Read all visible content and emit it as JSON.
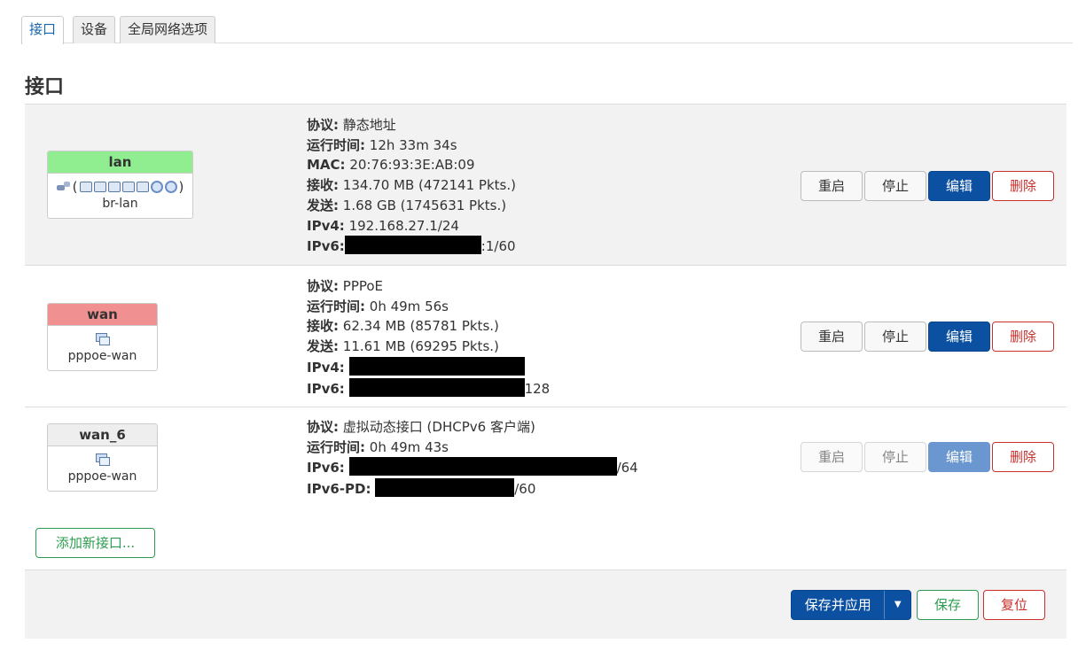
{
  "tabs": [
    {
      "label": "接口",
      "active": true
    },
    {
      "label": "设备",
      "active": false
    },
    {
      "label": "全局网络选项",
      "active": false
    }
  ],
  "page_title": "接口",
  "interfaces": [
    {
      "name": "lan",
      "name_color": "#90ee90",
      "device": "br-lan",
      "info": [
        {
          "label": "协议:",
          "value": "静态地址"
        },
        {
          "label": "运行时间:",
          "value": "12h 33m 34s"
        },
        {
          "label": "MAC:",
          "value": "20:76:93:3E:AB:09"
        },
        {
          "label": "接收:",
          "value": "134.70 MB (472141 Pkts.)"
        },
        {
          "label": "发送:",
          "value": "1.68 GB (1745631 Pkts.)"
        },
        {
          "label": "IPv4:",
          "value": "192.168.27.1/24"
        },
        {
          "label": "IPv6:",
          "value": ":1/60",
          "redacted": true
        }
      ],
      "buttons": {
        "restart": "重启",
        "stop": "停止",
        "edit": "编辑",
        "delete": "删除"
      }
    },
    {
      "name": "wan",
      "name_color": "#f09090",
      "device": "pppoe-wan",
      "info": [
        {
          "label": "协议:",
          "value": "PPPoE"
        },
        {
          "label": "运行时间:",
          "value": "0h 49m 56s"
        },
        {
          "label": "接收:",
          "value": "62.34 MB (85781 Pkts.)"
        },
        {
          "label": "发送:",
          "value": "11.61 MB (69295 Pkts.)"
        },
        {
          "label": "IPv4:",
          "value": "",
          "redacted": true
        },
        {
          "label": "IPv6:",
          "value": "128",
          "redacted": true
        }
      ],
      "buttons": {
        "restart": "重启",
        "stop": "停止",
        "edit": "编辑",
        "delete": "删除"
      }
    },
    {
      "name": "wan_6",
      "name_color": "#eeeeee",
      "device": "pppoe-wan",
      "info": [
        {
          "label": "协议:",
          "value": "虚拟动态接口 (DHCPv6 客户端)"
        },
        {
          "label": "运行时间:",
          "value": "0h 49m 43s"
        },
        {
          "label": "IPv6:",
          "value": "/64",
          "redacted": true
        },
        {
          "label": "IPv6-PD:",
          "value": "/60",
          "redacted": true
        }
      ],
      "buttons": {
        "restart": "重启",
        "stop": "停止",
        "edit": "编辑",
        "delete": "删除"
      },
      "buttons_disabled": true
    }
  ],
  "add_button": "添加新接口...",
  "footer": {
    "save_apply": "保存并应用",
    "save": "保存",
    "reset": "复位"
  }
}
